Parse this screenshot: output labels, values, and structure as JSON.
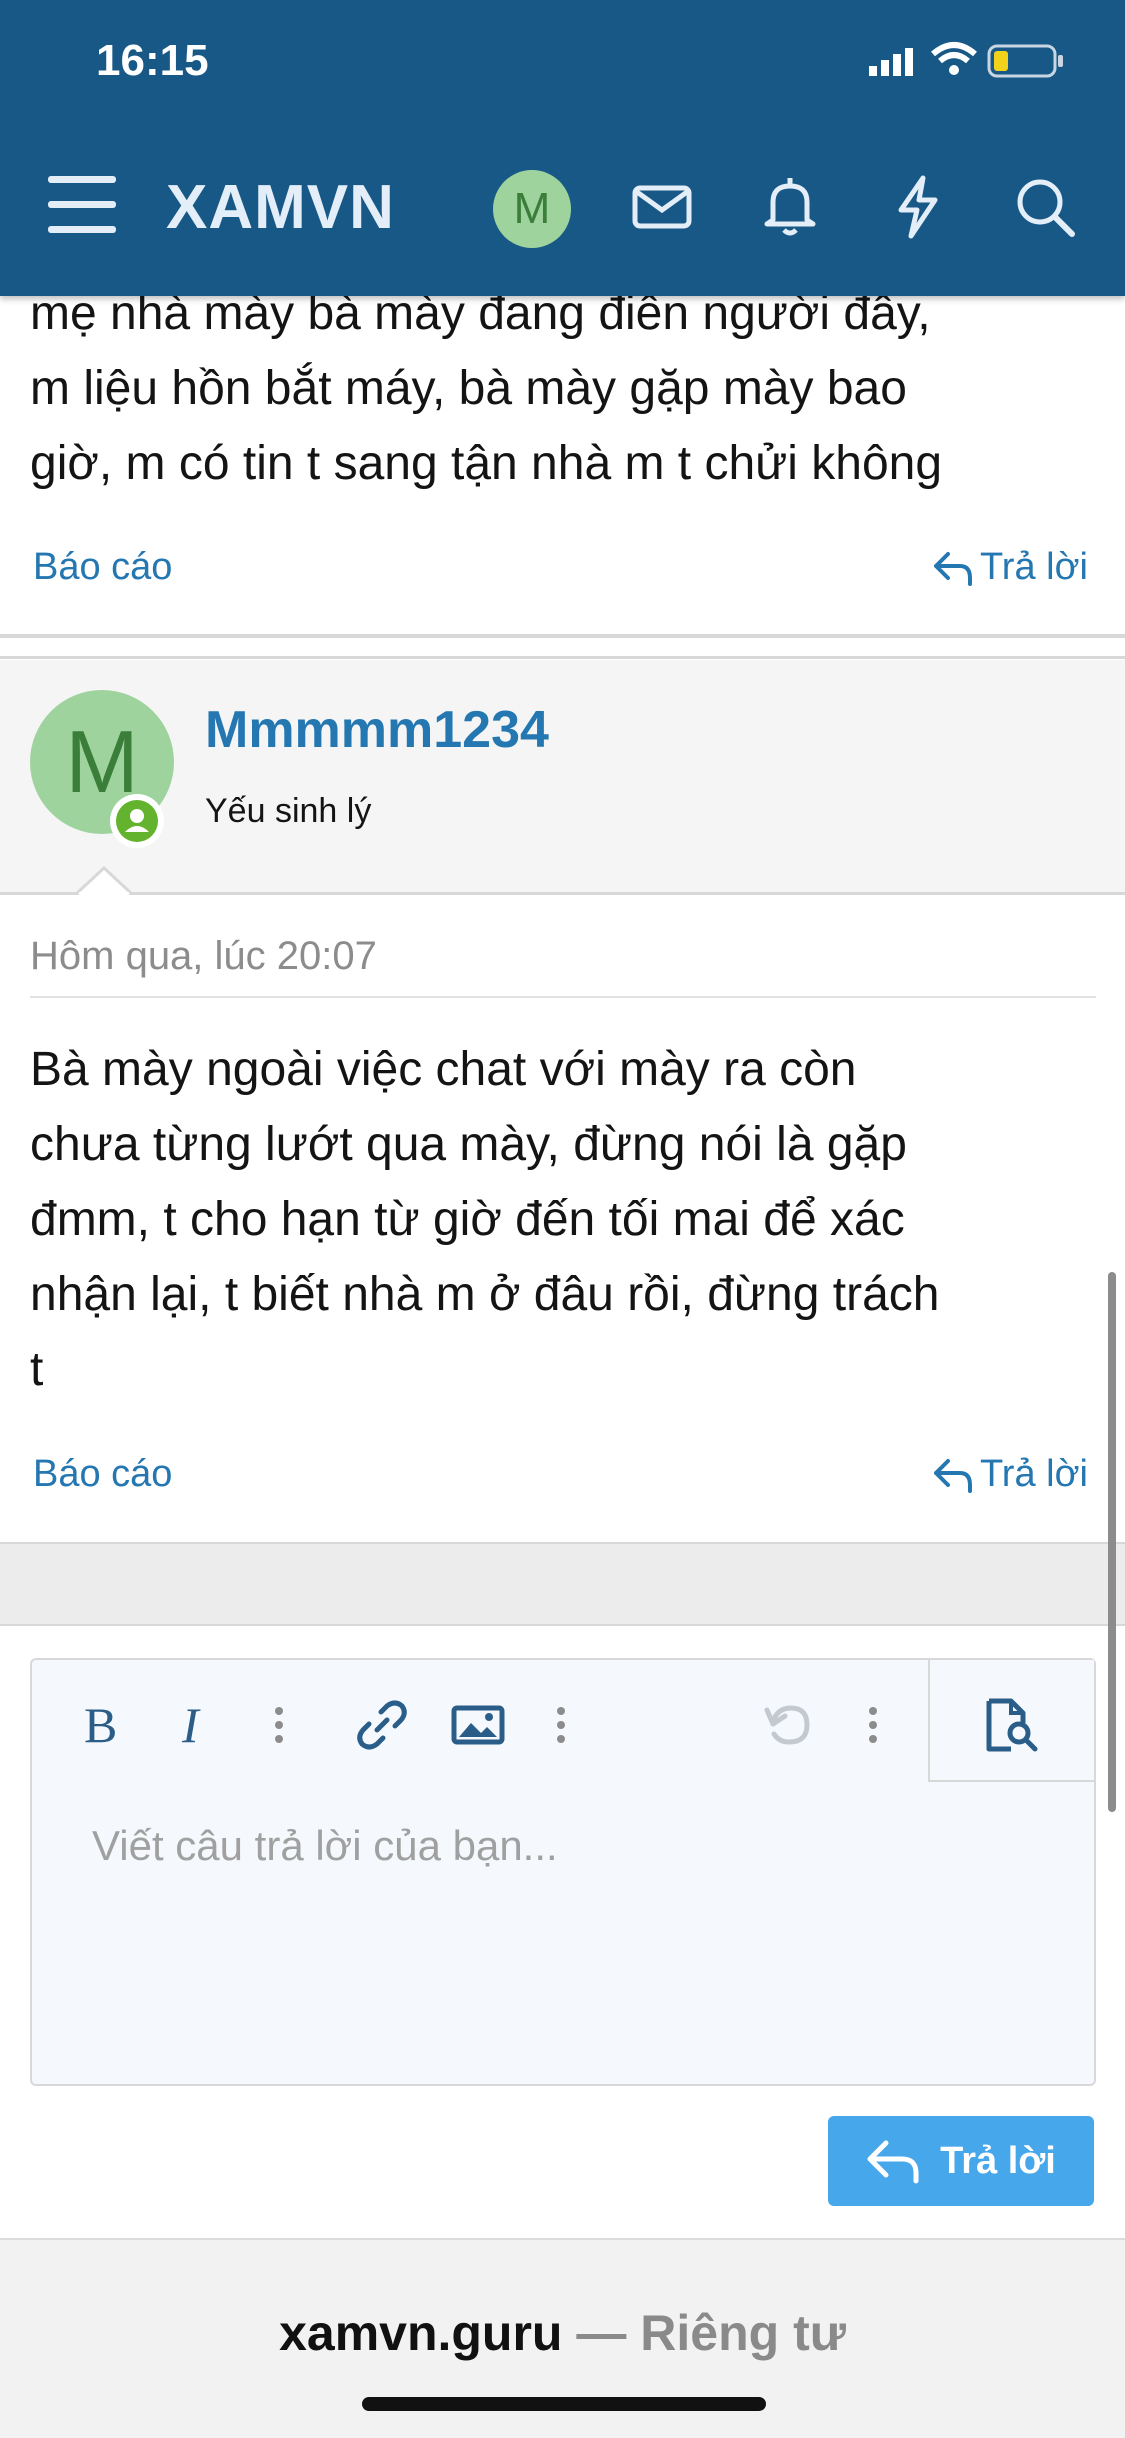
{
  "status_bar": {
    "time": "16:15"
  },
  "nav": {
    "brand": "XAMVN",
    "avatar_letter": "M"
  },
  "previous_post": {
    "lines": [
      "mẹ nhà mày bà mày đang điên người đây,",
      "m liệu hồn bắt máy, bà mày gặp mày bao",
      "giờ, m có tin t sang tận nhà m t chửi không"
    ],
    "report_label": "Báo cáo",
    "reply_label": "Trả lời"
  },
  "post": {
    "avatar_letter": "M",
    "username": "Mmmmm1234",
    "user_title": "Yếu sinh lý",
    "date": "Hôm qua, lúc 20:07",
    "lines": [
      "Bà mày ngoài việc chat với mày ra còn",
      "chưa từng lướt qua mày, đừng nói là gặp",
      "đmm, t cho hạn từ giờ đến tối mai để xác",
      "nhận lại, t biết nhà m ở đâu rồi, đừng trách",
      "t"
    ],
    "report_label": "Báo cáo",
    "reply_label": "Trả lời"
  },
  "editor": {
    "placeholder": "Viết câu trả lời của bạn...",
    "submit_label": "Trả lời"
  },
  "browser": {
    "host": "xamvn.guru",
    "separator": " — ",
    "privacy": "Riêng tư"
  },
  "colors": {
    "header": "#185886",
    "link": "#2577b1",
    "button": "#47a7eb",
    "avatar": "#9ed39e"
  }
}
